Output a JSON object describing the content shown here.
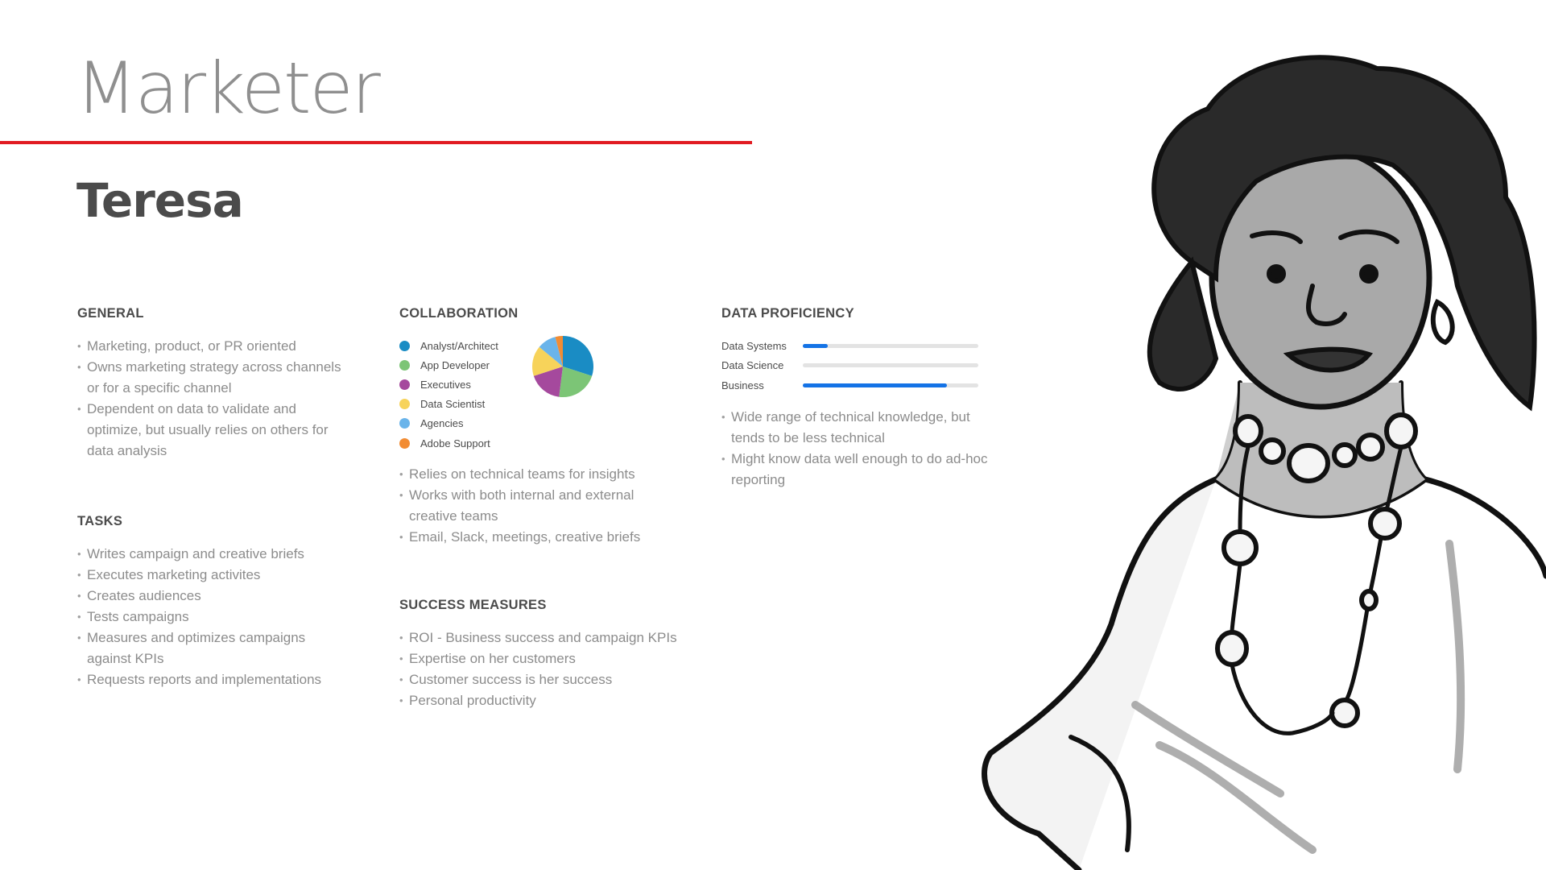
{
  "header": {
    "role": "Marketer",
    "name": "Teresa"
  },
  "colors": {
    "accent_red": "#e11b22",
    "progress_blue": "#1473e6"
  },
  "general": {
    "title": "GENERAL",
    "items": [
      "Marketing, product, or PR oriented",
      "Owns marketing strategy across channels or for a specific channel",
      "Dependent on data to validate and optimize, but usually relies on others for data analysis"
    ]
  },
  "tasks": {
    "title": "TASKS",
    "items": [
      "Writes campaign and creative briefs",
      "Executes marketing activites",
      "Creates audiences",
      "Tests campaigns",
      "Measures and optimizes campaigns against KPIs",
      "Requests reports and implementations"
    ]
  },
  "collaboration": {
    "title": "COLLABORATION",
    "items": [
      "Relies on technical teams for insights",
      "Works with both internal and external creative teams",
      "Email, Slack, meetings, creative briefs"
    ]
  },
  "chart_data": {
    "type": "pie",
    "categories": [
      "Analyst/Architect",
      "App Developer",
      "Executives",
      "Data Scientist",
      "Agencies",
      "Adobe Support"
    ],
    "values": [
      30,
      22,
      18,
      16,
      10,
      4
    ],
    "colors": [
      "#1a8cc4",
      "#7cc576",
      "#a5499d",
      "#f7d35a",
      "#6ab4ea",
      "#f28c33"
    ],
    "legend": "left"
  },
  "success": {
    "title": "SUCCESS MEASURES",
    "items": [
      "ROI - Business success and campaign KPIs",
      "Expertise on her customers",
      "Customer success is her success",
      "Personal productivity"
    ]
  },
  "proficiency": {
    "title": "DATA PROFICIENCY",
    "levels": [
      {
        "label": "Data Systems",
        "fraction": 0.14
      },
      {
        "label": "Data Science",
        "fraction": 0.0
      },
      {
        "label": "Business",
        "fraction": 0.82
      }
    ],
    "items": [
      "Wide range of technical knowledge, but tends to be less technical",
      "Might know data well enough to do ad-hoc reporting"
    ]
  }
}
